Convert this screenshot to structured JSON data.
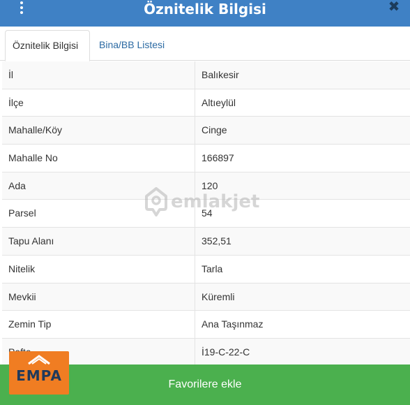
{
  "header": {
    "title": "Öznitelik Bilgisi",
    "close_label": "✖"
  },
  "tabs": [
    {
      "label": "Öznitelik Bilgisi",
      "active": true
    },
    {
      "label": "Bina/BB Listesi",
      "active": false
    }
  ],
  "rows": [
    {
      "label": "İl",
      "value": "Balıkesir"
    },
    {
      "label": "İlçe",
      "value": "Altıeylül"
    },
    {
      "label": "Mahalle/Köy",
      "value": "Cinge"
    },
    {
      "label": "Mahalle No",
      "value": "166897"
    },
    {
      "label": "Ada",
      "value": "120"
    },
    {
      "label": "Parsel",
      "value": "54"
    },
    {
      "label": "Tapu Alanı",
      "value": "352,51"
    },
    {
      "label": "Nitelik",
      "value": "Tarla"
    },
    {
      "label": "Mevkii",
      "value": "Küremli"
    },
    {
      "label": "Zemin Tip",
      "value": "Ana Taşınmaz"
    },
    {
      "label": "Pafta",
      "value": "İ19-C-22-C"
    }
  ],
  "footer": {
    "button_label": "Favorilere ekle"
  },
  "watermark": {
    "text": "emlakjet"
  },
  "logo": {
    "text": "EMPA"
  },
  "colors": {
    "header": "#3f81c5",
    "footer": "#4bb04e",
    "tab_link": "#2b6aa3",
    "logo_bg": "#f07d22"
  }
}
